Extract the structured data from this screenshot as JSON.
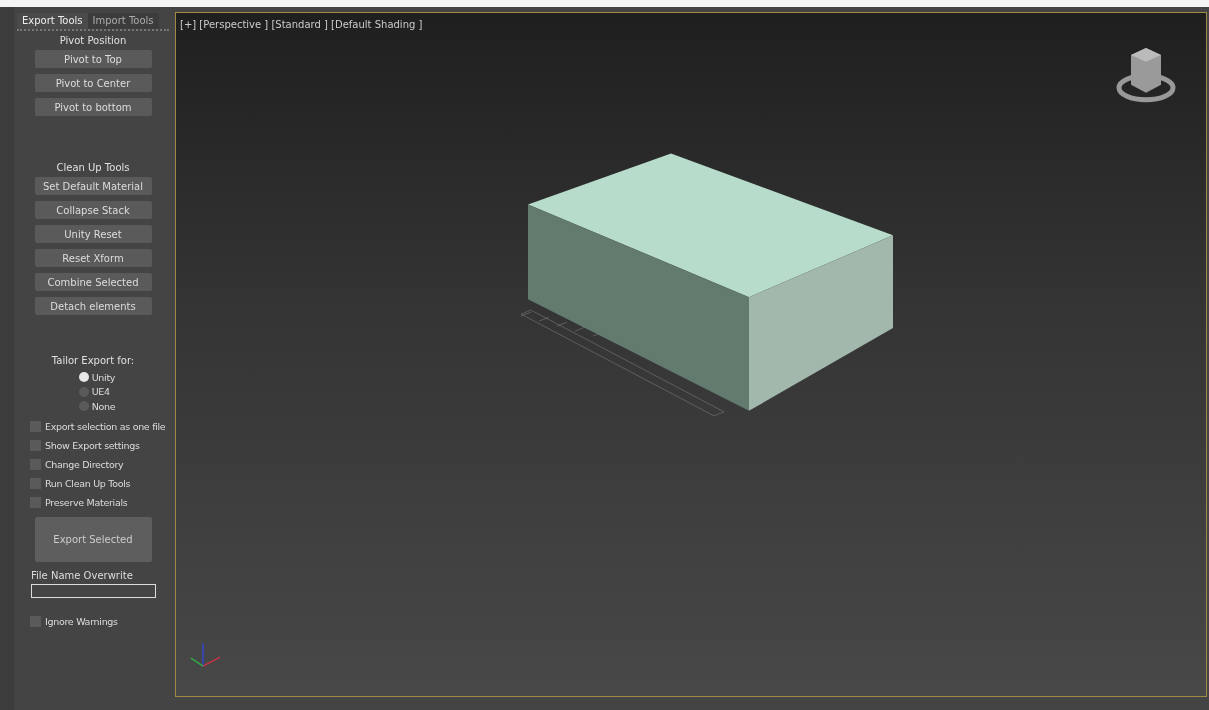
{
  "tabs": [
    {
      "label": "Export Tools",
      "selected": true
    },
    {
      "label": "Import Tools",
      "selected": false
    }
  ],
  "sections": [
    {
      "title": "Pivot Position",
      "buttons": [
        "Pivot to Top",
        "Pivot to Center",
        "Pivot to bottom"
      ]
    },
    {
      "title": "Clean Up Tools",
      "buttons": [
        "Set Default Material",
        "Collapse Stack",
        "Unity Reset",
        "Reset Xform",
        "Combine Selected",
        "Detach elements"
      ]
    }
  ],
  "tailor": {
    "title": "Tailor Export for:",
    "options": [
      {
        "label": "Unity",
        "selected": true
      },
      {
        "label": "UE4",
        "selected": false
      },
      {
        "label": "None",
        "selected": false
      }
    ]
  },
  "options": [
    {
      "label": "Export selection as one file",
      "checked": false
    },
    {
      "label": "Show Export settings",
      "checked": false
    },
    {
      "label": "Change Directory",
      "checked": false
    },
    {
      "label": "Run Clean Up Tools",
      "checked": false
    },
    {
      "label": "Preserve Materials",
      "checked": false
    }
  ],
  "export_button": "Export Selected",
  "file_name": {
    "label": "File Name Overwrite"
  },
  "ignore_warnings": {
    "label": "Ignore Warnings",
    "checked": false
  },
  "viewport": {
    "label": "[+] [Perspective ] [Standard ] [Default Shading ]"
  }
}
